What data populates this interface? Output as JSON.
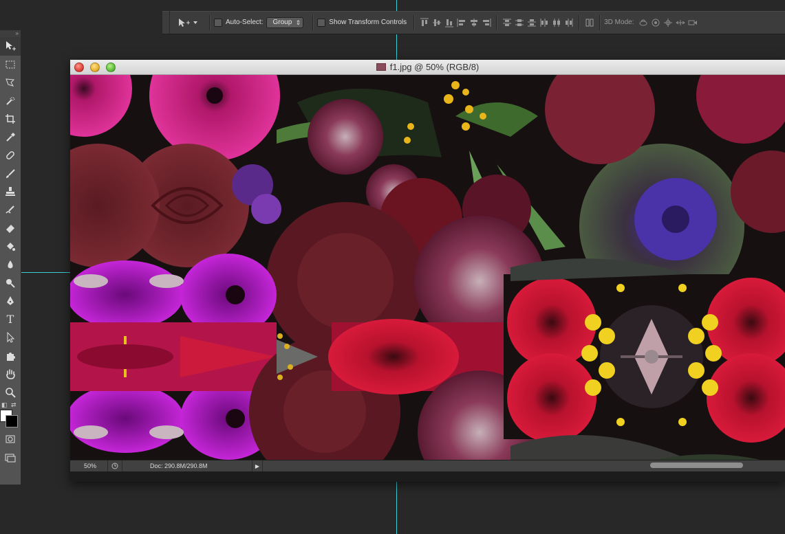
{
  "options_bar": {
    "auto_select_label": "Auto-Select:",
    "auto_select_value": "Group",
    "show_transform_label": "Show Transform Controls",
    "mode_3d_label": "3D Mode:"
  },
  "toolbox": {
    "header": "»",
    "tools": [
      "move-tool",
      "marquee-tool",
      "lasso-tool",
      "quick-selection-tool",
      "crop-tool",
      "eyedropper-tool",
      "healing-brush-tool",
      "brush-tool",
      "clone-stamp-tool",
      "history-brush-tool",
      "eraser-tool",
      "paint-bucket-tool",
      "blur-tool",
      "dodge-tool",
      "pen-tool",
      "type-tool",
      "path-selection-tool",
      "custom-shape-tool",
      "hand-tool",
      "zoom-tool"
    ],
    "type_tool_glyph": "T",
    "foreground_color": "#ffffff",
    "background_color": "#000000"
  },
  "document": {
    "title": "f1.jpg @ 50% (RGB/8)",
    "zoom": "50%",
    "doc_size": "Doc: 290.8M/290.8M"
  },
  "colors": {
    "guide": "#3fd0d8",
    "app_background": "#282828",
    "canvas_base": "#1a1414"
  }
}
